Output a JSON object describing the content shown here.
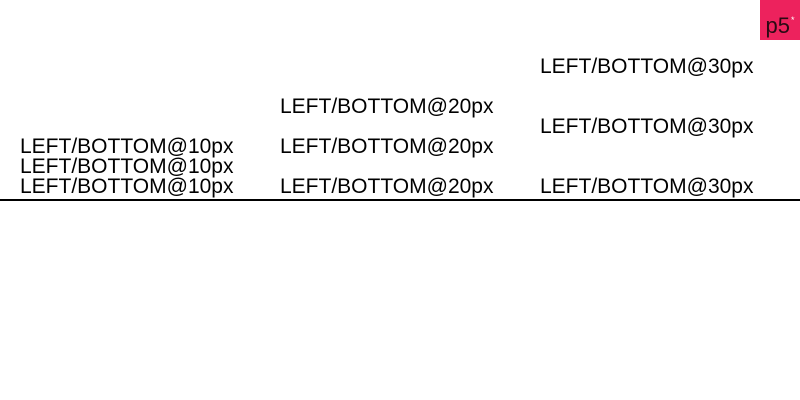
{
  "logo": {
    "text": "p5",
    "mark": "*",
    "color": "#ed225d"
  },
  "baseline": {
    "color": "#000000"
  },
  "columns": [
    {
      "lines": [
        "LEFT/BOTTOM@10px",
        "LEFT/BOTTOM@10px",
        "LEFT/BOTTOM@10px"
      ]
    },
    {
      "lines": [
        "LEFT/BOTTOM@20px",
        "LEFT/BOTTOM@20px",
        "LEFT/BOTTOM@20px"
      ]
    },
    {
      "lines": [
        "LEFT/BOTTOM@30px",
        "LEFT/BOTTOM@30px",
        "LEFT/BOTTOM@30px"
      ]
    }
  ]
}
